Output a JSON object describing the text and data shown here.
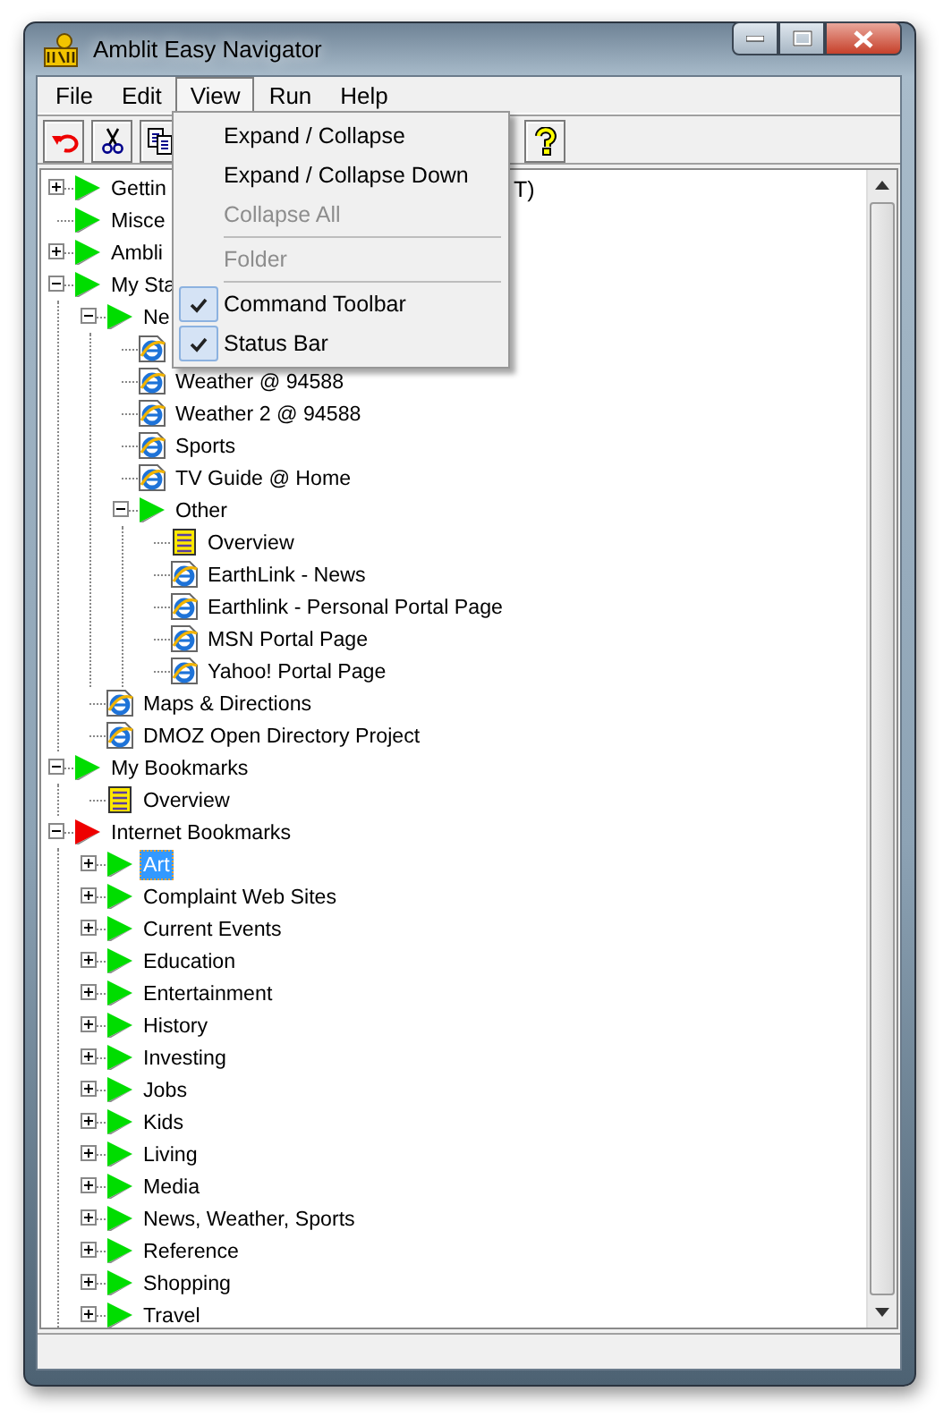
{
  "window": {
    "title": "Amblit Easy Navigator"
  },
  "menubar": [
    {
      "label": "File",
      "selected": false
    },
    {
      "label": "Edit",
      "selected": false
    },
    {
      "label": "View",
      "selected": true
    },
    {
      "label": "Run",
      "selected": false
    },
    {
      "label": "Help",
      "selected": false
    }
  ],
  "toolbar": [
    {
      "kind": "undo"
    },
    {
      "kind": "cut"
    },
    {
      "kind": "copy"
    },
    {
      "kind": "gap"
    },
    {
      "kind": "help"
    }
  ],
  "view_menu": [
    {
      "kind": "item",
      "label": "Expand / Collapse",
      "disabled": false,
      "checked": false
    },
    {
      "kind": "item",
      "label": "Expand / Collapse Down",
      "disabled": false,
      "checked": false
    },
    {
      "kind": "item",
      "label": "Collapse All",
      "disabled": true,
      "checked": false
    },
    {
      "kind": "separator"
    },
    {
      "kind": "item",
      "label": "Folder",
      "disabled": true,
      "checked": false
    },
    {
      "kind": "separator"
    },
    {
      "kind": "item",
      "label": "Command Toolbar",
      "disabled": false,
      "checked": true
    },
    {
      "kind": "item",
      "label": "Status Bar",
      "disabled": false,
      "checked": true
    }
  ],
  "tree": [
    {
      "kind": "folder",
      "label": "Gettin",
      "tail": "T)",
      "color": "#00dd00",
      "expanded": false,
      "selected": false
    },
    {
      "kind": "folder",
      "label": "Misce",
      "color": "#00dd00",
      "selected": false
    },
    {
      "kind": "folder",
      "label": "Ambli",
      "color": "#00dd00",
      "expanded": false,
      "selected": false
    },
    {
      "kind": "folder",
      "label": "My Sta",
      "color": "#00dd00",
      "expanded": true,
      "selected": false,
      "children": [
        {
          "kind": "folder",
          "label": "Ne",
          "color": "#00dd00",
          "expanded": true,
          "selected": false,
          "children": [
            {
              "kind": "link",
              "selected": false
            },
            {
              "kind": "link",
              "label": "Weather @ 94588",
              "selected": false
            },
            {
              "kind": "link",
              "label": "Weather 2 @ 94588",
              "selected": false
            },
            {
              "kind": "link",
              "label": "Sports",
              "selected": false
            },
            {
              "kind": "link",
              "label": "TV Guide @ Home",
              "selected": false
            },
            {
              "kind": "folder",
              "label": "Other",
              "color": "#00dd00",
              "expanded": true,
              "selected": false,
              "children": [
                {
                  "kind": "note",
                  "label": "Overview",
                  "selected": false
                },
                {
                  "kind": "link",
                  "label": "EarthLink - News",
                  "selected": false
                },
                {
                  "kind": "link",
                  "label": "Earthlink - Personal Portal Page",
                  "selected": false
                },
                {
                  "kind": "link",
                  "label": "MSN Portal Page",
                  "selected": false
                },
                {
                  "kind": "link",
                  "label": "Yahoo! Portal Page",
                  "selected": false
                }
              ]
            }
          ]
        },
        {
          "kind": "link",
          "label": "Maps & Directions",
          "selected": false
        },
        {
          "kind": "link",
          "label": "DMOZ Open Directory Project",
          "selected": false
        }
      ]
    },
    {
      "kind": "folder",
      "label": "My Bookmarks",
      "color": "#00dd00",
      "expanded": true,
      "selected": false,
      "children": [
        {
          "kind": "note",
          "label": "Overview",
          "selected": false
        }
      ]
    },
    {
      "kind": "folder",
      "label": "Internet Bookmarks",
      "color": "#ee0000",
      "expanded": true,
      "selected": false,
      "children": [
        {
          "kind": "folder",
          "label": "Art",
          "color": "#00dd00",
          "expanded": false,
          "selected": true
        },
        {
          "kind": "folder",
          "label": "Complaint Web Sites",
          "color": "#00dd00",
          "expanded": false,
          "selected": false
        },
        {
          "kind": "folder",
          "label": "Current Events",
          "color": "#00dd00",
          "expanded": false,
          "selected": false
        },
        {
          "kind": "folder",
          "label": "Education",
          "color": "#00dd00",
          "expanded": false,
          "selected": false
        },
        {
          "kind": "folder",
          "label": "Entertainment",
          "color": "#00dd00",
          "expanded": false,
          "selected": false
        },
        {
          "kind": "folder",
          "label": "History",
          "color": "#00dd00",
          "expanded": false,
          "selected": false
        },
        {
          "kind": "folder",
          "label": "Investing",
          "color": "#00dd00",
          "expanded": false,
          "selected": false
        },
        {
          "kind": "folder",
          "label": "Jobs",
          "color": "#00dd00",
          "expanded": false,
          "selected": false
        },
        {
          "kind": "folder",
          "label": "Kids",
          "color": "#00dd00",
          "expanded": false,
          "selected": false
        },
        {
          "kind": "folder",
          "label": "Living",
          "color": "#00dd00",
          "expanded": false,
          "selected": false
        },
        {
          "kind": "folder",
          "label": "Media",
          "color": "#00dd00",
          "expanded": false,
          "selected": false
        },
        {
          "kind": "folder",
          "label": "News, Weather, Sports",
          "color": "#00dd00",
          "expanded": false,
          "selected": false
        },
        {
          "kind": "folder",
          "label": "Reference",
          "color": "#00dd00",
          "expanded": false,
          "selected": false
        },
        {
          "kind": "folder",
          "label": "Shopping",
          "color": "#00dd00",
          "expanded": false,
          "selected": false
        },
        {
          "kind": "folder",
          "label": "Travel",
          "color": "#00dd00",
          "expanded": false,
          "selected": false
        }
      ]
    }
  ]
}
